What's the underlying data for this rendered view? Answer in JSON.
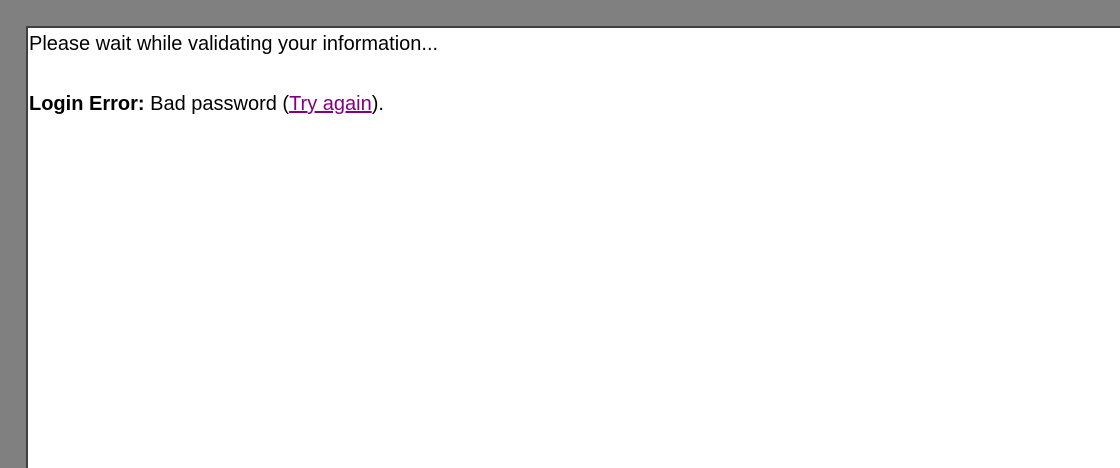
{
  "status_message": "Please wait while validating your information...",
  "error": {
    "label": "Login Error:",
    "message": "Bad password (",
    "link_text": "Try again",
    "suffix": ")."
  },
  "colors": {
    "frame_border": "#808080",
    "frame_inner_edge": "#404040",
    "background": "#ffffff",
    "text": "#000000",
    "visited_link": "#800080"
  }
}
